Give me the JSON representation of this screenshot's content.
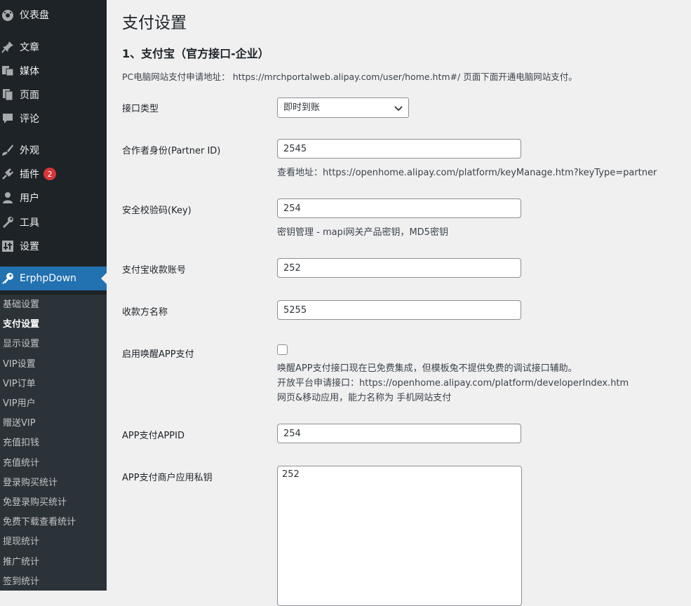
{
  "sidebar": {
    "items": [
      {
        "label": "仪表盘",
        "icon": "dashboard-icon"
      },
      {
        "label": "文章",
        "icon": "pin-icon"
      },
      {
        "label": "媒体",
        "icon": "media-icon"
      },
      {
        "label": "页面",
        "icon": "page-icon"
      },
      {
        "label": "评论",
        "icon": "comment-icon"
      },
      {
        "label": "外观",
        "icon": "brush-icon"
      },
      {
        "label": "插件",
        "icon": "plugin-icon",
        "badge": "2"
      },
      {
        "label": "用户",
        "icon": "user-icon"
      },
      {
        "label": "工具",
        "icon": "wrench-icon"
      },
      {
        "label": "设置",
        "icon": "settings-icon"
      },
      {
        "label": "ErphpDown",
        "icon": "key-icon"
      }
    ],
    "submenu": [
      "基础设置",
      "支付设置",
      "显示设置",
      "VIP设置",
      "VIP订单",
      "VIP用户",
      "赠送VIP",
      "充值扣钱",
      "充值统计",
      "登录购买统计",
      "免登录购买统计",
      "免费下载查看统计",
      "提现统计",
      "推广统计",
      "签到统计"
    ],
    "active_color": "#2271b1",
    "bg_color": "#1d2327"
  },
  "main": {
    "title": "支付设置",
    "section_title": "1、支付宝（官方接口-企业）",
    "description": "PC电脑网站支付申请地址： https://mrchportalweb.alipay.com/user/home.htm#/ 页面下面开通电脑网站支付。",
    "fields": {
      "interface_type": {
        "label": "接口类型",
        "value": "即时到账"
      },
      "partner_id": {
        "label": "合作者身份(Partner ID)",
        "value": "2545",
        "help": "查看地址：https://openhome.alipay.com/platform/keyManage.htm?keyType=partner"
      },
      "key": {
        "label": "安全校验码(Key)",
        "value": "254",
        "help": "密钥管理 - mapi网关产品密钥，MD5密钥"
      },
      "account": {
        "label": "支付宝收款账号",
        "value": "252"
      },
      "payee_name": {
        "label": "收款方名称",
        "value": "5255"
      },
      "app_pay": {
        "label": "启用唤醒APP支付",
        "checked": false,
        "help1": "唤醒APP支付接口现在已免费集成，但模板兔不提供免费的调试接口辅助。",
        "help2": "开放平台申请接口：https://openhome.alipay.com/platform/developerIndex.htm",
        "help3": "网页&移动应用，能力名称为 手机网站支付"
      },
      "app_id": {
        "label": "APP支付APPID",
        "value": "254"
      },
      "app_private_key": {
        "label": "APP支付商户应用私钥",
        "value": "252"
      }
    }
  }
}
